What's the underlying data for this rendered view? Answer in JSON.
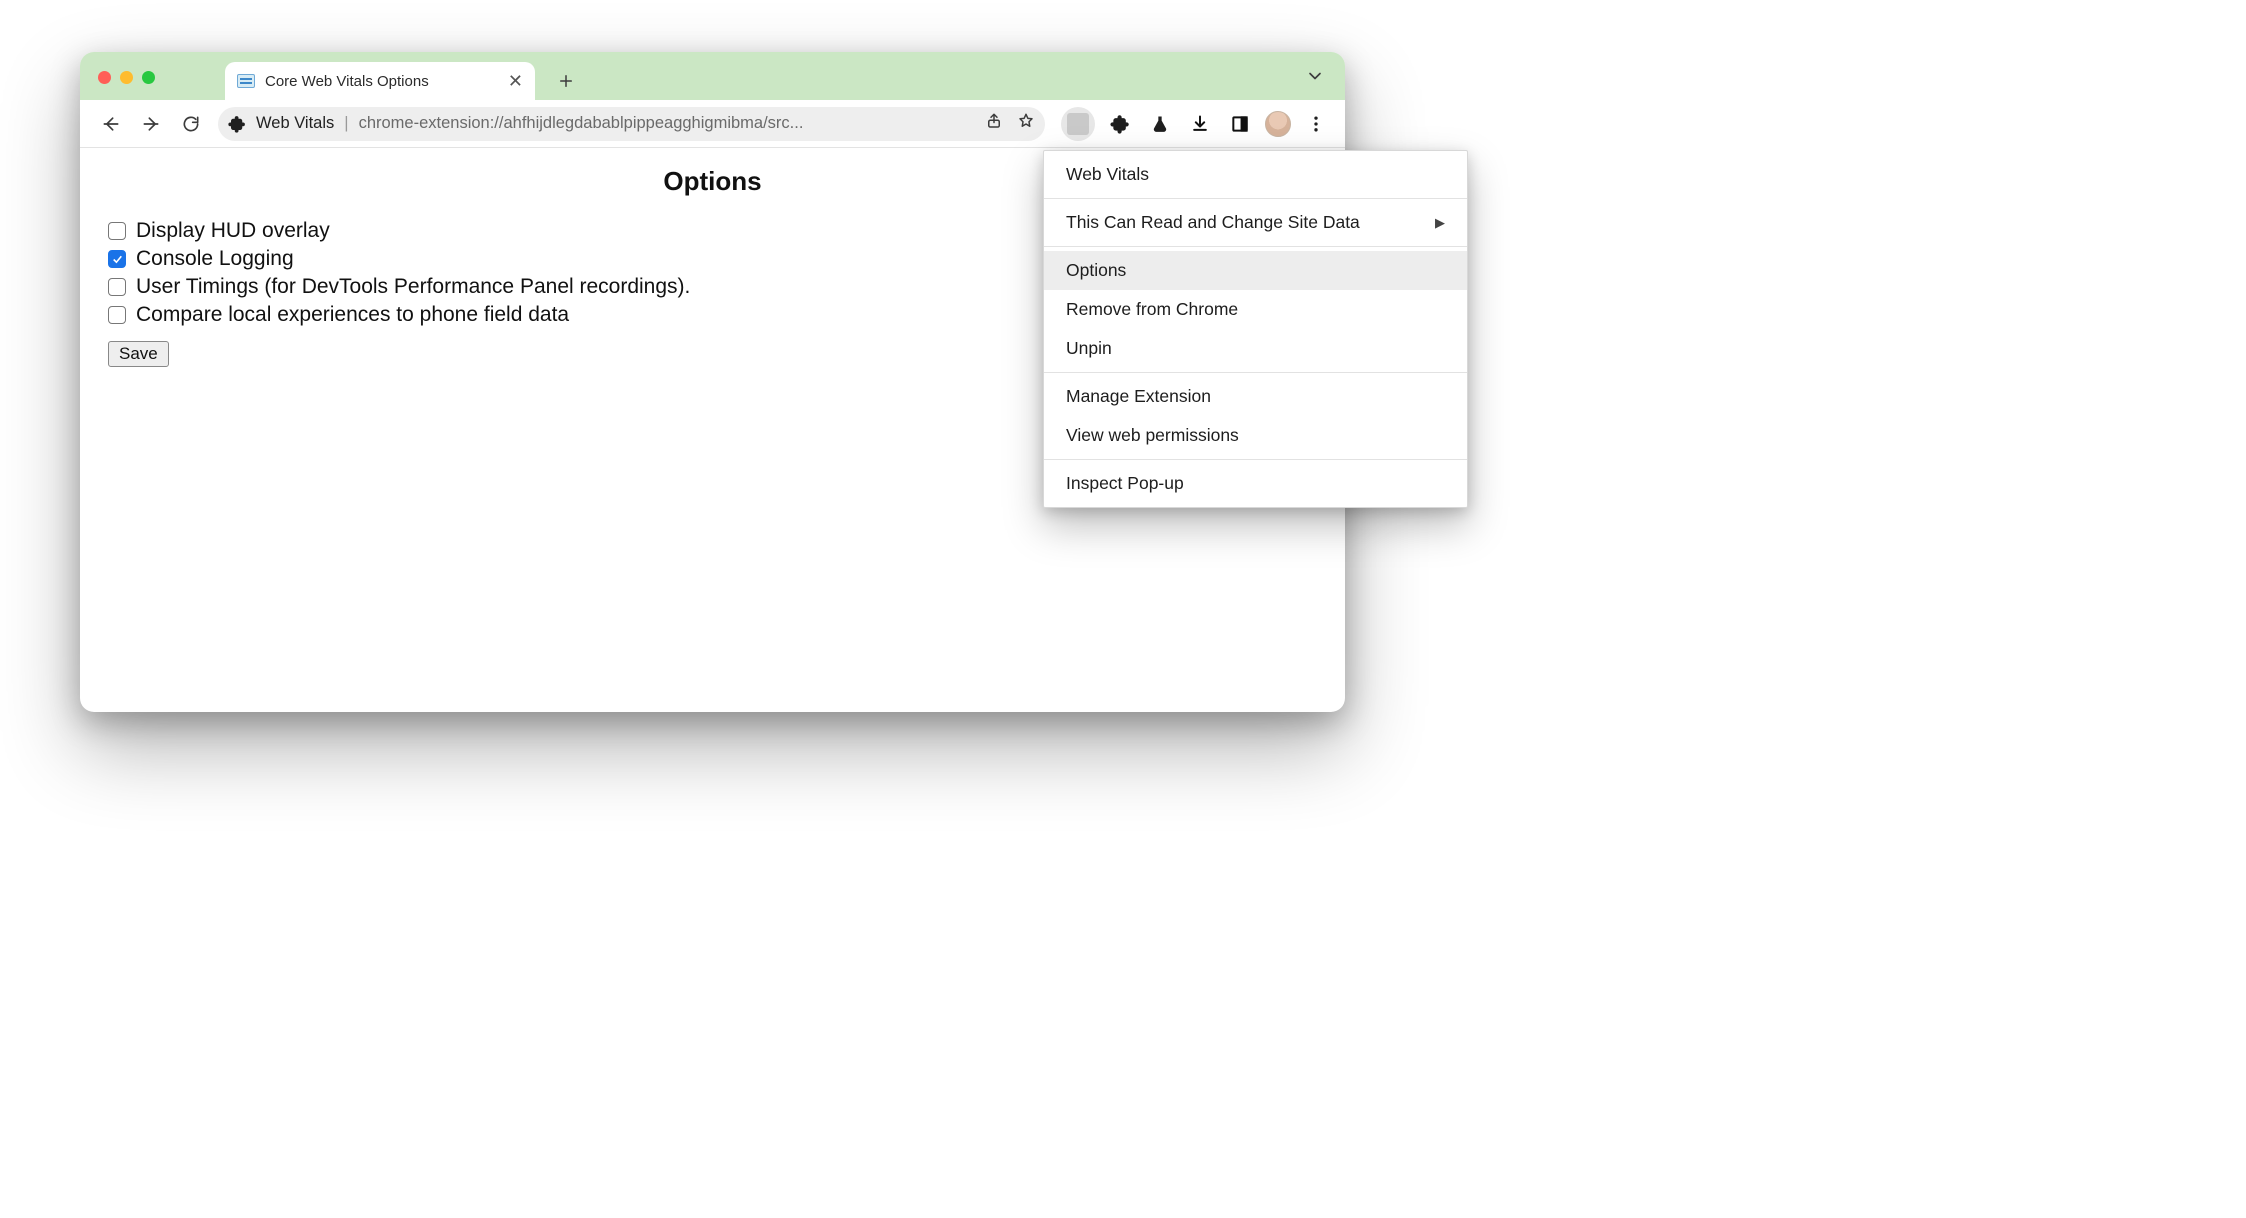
{
  "tab": {
    "title": "Core Web Vitals Options"
  },
  "omnibox": {
    "ext_label": "Web Vitals",
    "url": "chrome-extension://ahfhijdlegdabablpippeagghigmibma/src..."
  },
  "page": {
    "heading": "Options",
    "options": [
      {
        "label": "Display HUD overlay",
        "checked": false
      },
      {
        "label": "Console Logging",
        "checked": true
      },
      {
        "label": "User Timings (for DevTools Performance Panel recordings).",
        "checked": false
      },
      {
        "label": "Compare local experiences to phone field data",
        "checked": false
      }
    ],
    "save_label": "Save"
  },
  "context_menu": {
    "title": "Web Vitals",
    "site_data": "This Can Read and Change Site Data",
    "options": "Options",
    "remove": "Remove from Chrome",
    "unpin": "Unpin",
    "manage": "Manage Extension",
    "view_perm": "View web permissions",
    "inspect": "Inspect Pop-up"
  }
}
